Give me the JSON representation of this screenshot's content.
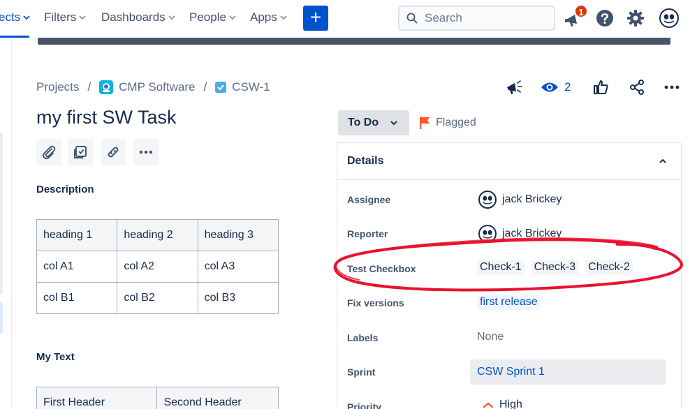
{
  "nav": {
    "items": [
      {
        "label": "ects",
        "active": true
      },
      {
        "label": "Filters"
      },
      {
        "label": "Dashboards"
      },
      {
        "label": "People"
      },
      {
        "label": "Apps"
      }
    ],
    "create_label": "+",
    "search_placeholder": "Search",
    "notification_count": "1"
  },
  "breadcrumb": {
    "projects": "Projects",
    "project": "CMP Software",
    "issue_key": "CSW-1",
    "separator": "/"
  },
  "header_actions": {
    "watch_count": "2"
  },
  "issue": {
    "title": "my first SW Task",
    "description_heading": "Description",
    "description_table": {
      "headers": [
        "heading 1",
        "heading 2",
        "heading 3"
      ],
      "rows": [
        [
          "col A1",
          "col A2",
          "col A3"
        ],
        [
          "col B1",
          "col B2",
          "col B3"
        ]
      ]
    },
    "my_text_heading": "My Text",
    "my_text_table": {
      "headers": [
        "First Header",
        "Second Header"
      ]
    }
  },
  "status": {
    "label": "To Do",
    "flagged_label": "Flagged"
  },
  "details": {
    "title": "Details",
    "fields": {
      "assignee": {
        "label": "Assignee",
        "value": "jack Brickey"
      },
      "reporter": {
        "label": "Reporter",
        "value": "jack Brickey"
      },
      "test_checkbox": {
        "label": "Test Checkbox",
        "values": [
          "Check-1",
          "Check-3",
          "Check-2"
        ]
      },
      "fix_versions": {
        "label": "Fix versions",
        "value": "first release"
      },
      "labels": {
        "label": "Labels",
        "value": "None"
      },
      "sprint": {
        "label": "Sprint",
        "value": "CSW Sprint 1"
      },
      "priority": {
        "label": "Priority",
        "value": "High"
      }
    }
  },
  "colors": {
    "brand_blue": "#0052cc",
    "flag_red": "#ff5630",
    "annotation_red": "#e8132d",
    "priority_orange": "#ff5630"
  }
}
